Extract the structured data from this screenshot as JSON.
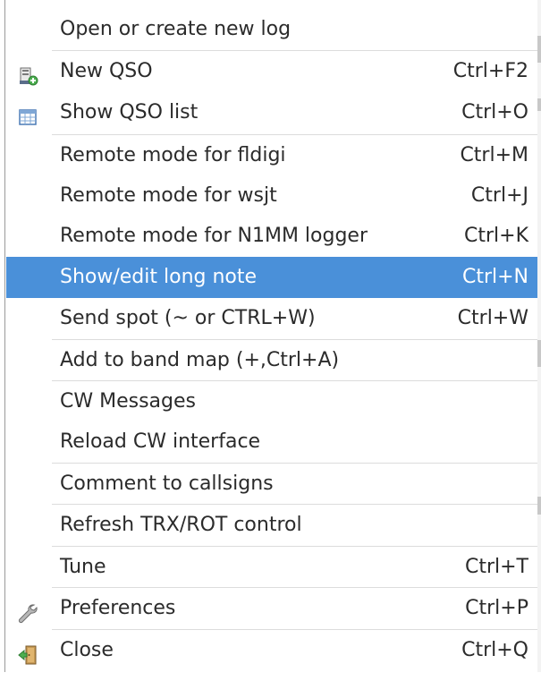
{
  "menu": {
    "items": [
      {
        "label": "Open or create new log",
        "shortcut": "",
        "icon": ""
      },
      {
        "label": "New QSO",
        "shortcut": "Ctrl+F2",
        "icon": "new-qso-icon"
      },
      {
        "label": "Show QSO list",
        "shortcut": "Ctrl+O",
        "icon": "table-icon"
      },
      {
        "label": "Remote mode for fldigi",
        "shortcut": "Ctrl+M",
        "icon": ""
      },
      {
        "label": "Remote mode for wsjt",
        "shortcut": "Ctrl+J",
        "icon": ""
      },
      {
        "label": "Remote mode for N1MM logger",
        "shortcut": "Ctrl+K",
        "icon": ""
      },
      {
        "label": "Show/edit long note",
        "shortcut": "Ctrl+N",
        "icon": "",
        "highlighted": true
      },
      {
        "label": "Send spot (~ or CTRL+W)",
        "shortcut": "Ctrl+W",
        "icon": ""
      },
      {
        "label": "Add to band map (+,Ctrl+A)",
        "shortcut": "",
        "icon": ""
      },
      {
        "label": "CW Messages",
        "shortcut": "",
        "icon": ""
      },
      {
        "label": "Reload CW interface",
        "shortcut": "",
        "icon": ""
      },
      {
        "label": "Comment to callsigns",
        "shortcut": "",
        "icon": ""
      },
      {
        "label": "Refresh TRX/ROT control",
        "shortcut": "",
        "icon": ""
      },
      {
        "label": "Tune",
        "shortcut": "Ctrl+T",
        "icon": ""
      },
      {
        "label": "Preferences",
        "shortcut": "Ctrl+P",
        "icon": "wrench-icon"
      },
      {
        "label": "Close",
        "shortcut": "Ctrl+Q",
        "icon": "exit-door-icon"
      }
    ]
  },
  "colors": {
    "highlight": "#4a90d9",
    "text": "#2b2b2b",
    "separator": "#dcdcdc"
  }
}
